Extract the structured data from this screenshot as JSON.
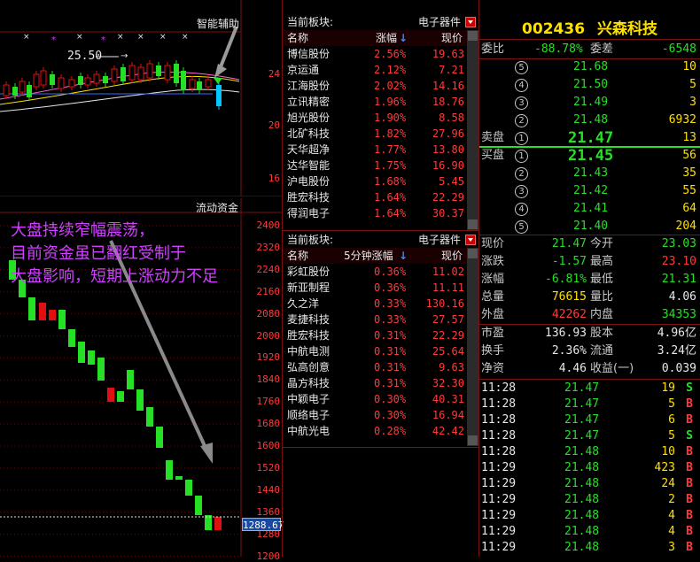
{
  "kline_panel": {
    "title": "智能辅助",
    "price_label": "25.50",
    "axis_labels": [
      "24",
      "20",
      "16"
    ]
  },
  "flow_panel": {
    "title": "流动资金",
    "axis_labels": [
      "2400",
      "2320",
      "2240",
      "2160",
      "2080",
      "2000",
      "1920",
      "1840",
      "1760",
      "1680",
      "1600",
      "1520",
      "1440",
      "1360",
      "1280",
      "1200"
    ],
    "current_value": "1288.67",
    "annotation_lines": [
      "大盘持续窄幅震荡，",
      "目前资金虽已翻红受制于",
      "大盘影响，短期上涨动力不足"
    ]
  },
  "sector1": {
    "header_label": "当前板块:",
    "dropdown_value": "电子器件",
    "columns": [
      "名称",
      "涨幅",
      "现价"
    ],
    "rows": [
      {
        "name": "博信股份",
        "pct": "2.56%",
        "price": "19.63"
      },
      {
        "name": "京运通",
        "pct": "2.12%",
        "price": "7.21"
      },
      {
        "name": "江海股份",
        "pct": "2.02%",
        "price": "14.16"
      },
      {
        "name": "立讯精密",
        "pct": "1.96%",
        "price": "18.76"
      },
      {
        "name": "旭光股份",
        "pct": "1.90%",
        "price": "8.58"
      },
      {
        "name": "北矿科技",
        "pct": "1.82%",
        "price": "27.96"
      },
      {
        "name": "天华超净",
        "pct": "1.77%",
        "price": "13.80"
      },
      {
        "name": "达华智能",
        "pct": "1.75%",
        "price": "16.90"
      },
      {
        "name": "沪电股份",
        "pct": "1.68%",
        "price": "5.45"
      },
      {
        "name": "胜宏科技",
        "pct": "1.64%",
        "price": "22.29"
      },
      {
        "name": "得润电子",
        "pct": "1.64%",
        "price": "30.37"
      }
    ]
  },
  "sector2": {
    "header_label": "当前板块:",
    "dropdown_value": "电子器件",
    "columns": [
      "名称",
      "5分钟涨幅",
      "现价"
    ],
    "rows": [
      {
        "name": "彩虹股份",
        "pct": "0.36%",
        "price": "11.02"
      },
      {
        "name": "新亚制程",
        "pct": "0.36%",
        "price": "11.11"
      },
      {
        "name": "久之洋",
        "pct": "0.33%",
        "price": "130.16"
      },
      {
        "name": "麦捷科技",
        "pct": "0.33%",
        "price": "27.57"
      },
      {
        "name": "胜宏科技",
        "pct": "0.31%",
        "price": "22.29"
      },
      {
        "name": "中航电测",
        "pct": "0.31%",
        "price": "25.64"
      },
      {
        "name": "弘高创意",
        "pct": "0.31%",
        "price": "9.63"
      },
      {
        "name": "晶方科技",
        "pct": "0.31%",
        "price": "32.30"
      },
      {
        "name": "中颖电子",
        "pct": "0.30%",
        "price": "40.31"
      },
      {
        "name": "顺络电子",
        "pct": "0.30%",
        "price": "16.94"
      },
      {
        "name": "中航光电",
        "pct": "0.28%",
        "price": "42.42"
      }
    ]
  },
  "quote": {
    "code": "002436",
    "name": "兴森科技",
    "weibi_label": "委比",
    "weibi": "-88.78%",
    "weicha_label": "委差",
    "weicha": "-6548",
    "sell_label": "卖盘",
    "buy_label": "买盘",
    "sells": [
      {
        "idx": "5",
        "price": "21.68",
        "vol": "10"
      },
      {
        "idx": "4",
        "price": "21.50",
        "vol": "5"
      },
      {
        "idx": "3",
        "price": "21.49",
        "vol": "3"
      },
      {
        "idx": "2",
        "price": "21.48",
        "vol": "6932"
      },
      {
        "idx": "1",
        "price": "21.47",
        "vol": "13"
      }
    ],
    "buys": [
      {
        "idx": "1",
        "price": "21.45",
        "vol": "56"
      },
      {
        "idx": "2",
        "price": "21.43",
        "vol": "35"
      },
      {
        "idx": "3",
        "price": "21.42",
        "vol": "55"
      },
      {
        "idx": "4",
        "price": "21.41",
        "vol": "64"
      },
      {
        "idx": "5",
        "price": "21.40",
        "vol": "204"
      }
    ],
    "stats": [
      {
        "l1": "现价",
        "v1": "21.47",
        "c1": "green",
        "l2": "今开",
        "v2": "23.03",
        "c2": "green"
      },
      {
        "l1": "涨跌",
        "v1": "-1.57",
        "c1": "green",
        "l2": "最高",
        "v2": "23.10",
        "c2": "red"
      },
      {
        "l1": "涨幅",
        "v1": "-6.81%",
        "c1": "green",
        "l2": "最低",
        "v2": "21.31",
        "c2": "green"
      },
      {
        "l1": "总量",
        "v1": "76615",
        "c1": "yellow",
        "l2": "量比",
        "v2": "4.06",
        "c2": "white"
      },
      {
        "l1": "外盘",
        "v1": "42262",
        "c1": "red",
        "l2": "内盘",
        "v2": "34353",
        "c2": "green"
      }
    ],
    "fin": [
      {
        "l1": "市盈",
        "v1": "136.93",
        "l2": "股本",
        "v2": "4.96亿"
      },
      {
        "l1": "换手",
        "v1": "2.36%",
        "l2": "流通",
        "v2": "3.24亿"
      },
      {
        "l1": "净资",
        "v1": "4.46",
        "l2": "收益(一)",
        "v2": "0.039"
      }
    ],
    "ticks": [
      {
        "time": "11:28",
        "price": "21.47",
        "vol": "19",
        "bs": "S"
      },
      {
        "time": "11:28",
        "price": "21.47",
        "vol": "5",
        "bs": "B"
      },
      {
        "time": "11:28",
        "price": "21.47",
        "vol": "6",
        "bs": "B"
      },
      {
        "time": "11:28",
        "price": "21.47",
        "vol": "5",
        "bs": "S"
      },
      {
        "time": "11:28",
        "price": "21.48",
        "vol": "10",
        "bs": "B"
      },
      {
        "time": "11:29",
        "price": "21.48",
        "vol": "423",
        "bs": "B"
      },
      {
        "time": "11:29",
        "price": "21.48",
        "vol": "24",
        "bs": "B"
      },
      {
        "time": "11:29",
        "price": "21.48",
        "vol": "2",
        "bs": "B"
      },
      {
        "time": "11:29",
        "price": "21.48",
        "vol": "4",
        "bs": "B"
      },
      {
        "time": "11:29",
        "price": "21.48",
        "vol": "4",
        "bs": "B"
      },
      {
        "time": "11:29",
        "price": "21.48",
        "vol": "3",
        "bs": "B"
      }
    ]
  }
}
